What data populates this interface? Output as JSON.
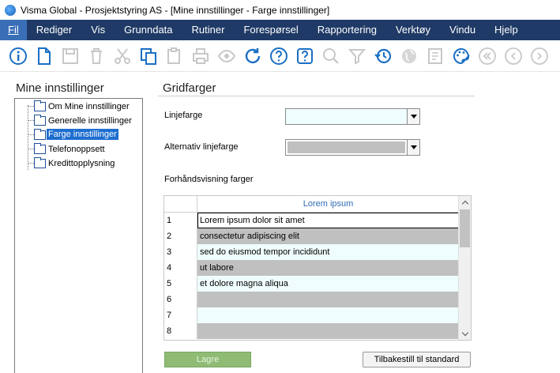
{
  "window": {
    "title": "Visma Global - Prosjektstyring AS - [Mine innstillinger - Farge innstillinger]"
  },
  "menu": [
    {
      "label": "Fil"
    },
    {
      "label": "Rediger"
    },
    {
      "label": "Vis"
    },
    {
      "label": "Grunndata"
    },
    {
      "label": "Rutiner"
    },
    {
      "label": "Forespørsel"
    },
    {
      "label": "Rapportering"
    },
    {
      "label": "Verktøy"
    },
    {
      "label": "Vindu"
    },
    {
      "label": "Hjelp"
    }
  ],
  "toolbar": {
    "icons": [
      "info-icon",
      "new-document-icon",
      "save-icon",
      "delete-icon",
      "cut-icon",
      "copy-icon",
      "paste-icon",
      "print-icon",
      "preview-icon",
      "refresh-icon",
      "help-icon",
      "context-help-icon",
      "search-icon",
      "filter-icon",
      "history-icon",
      "globe-icon",
      "notes-icon",
      "palette-icon",
      "first-icon",
      "previous-icon",
      "next-icon"
    ]
  },
  "sidebar": {
    "title": "Mine innstillinger",
    "items": [
      {
        "label": "Om Mine innstillinger",
        "selected": false
      },
      {
        "label": "Generelle innstillinger",
        "selected": false
      },
      {
        "label": "Farge innstillinger",
        "selected": true
      },
      {
        "label": "Telefonoppsett",
        "selected": false
      },
      {
        "label": "Kredittopplysning",
        "selected": false
      }
    ]
  },
  "main": {
    "title": "Gridfarger",
    "line_color_label": "Linjefarge",
    "line_color_value": "#f0fdfe",
    "alt_line_color_label": "Alternativ linjefarge",
    "alt_line_color_value": "#c0c0c0",
    "preview_label": "Forhåndsvisning farger",
    "grid": {
      "column_header": "Lorem ipsum",
      "rows": [
        {
          "num": "1",
          "text": "Lorem ipsum dolor sit amet"
        },
        {
          "num": "2",
          "text": "consectetur adipiscing elit"
        },
        {
          "num": "3",
          "text": "sed do eiusmod tempor incididunt"
        },
        {
          "num": "4",
          "text": "ut labore"
        },
        {
          "num": "5",
          "text": "et dolore magna aliqua"
        },
        {
          "num": "6",
          "text": ""
        },
        {
          "num": "7",
          "text": ""
        },
        {
          "num": "8",
          "text": ""
        }
      ]
    },
    "save_label": "Lagre",
    "reset_label": "Tilbakestill til standard"
  },
  "colors": {
    "menubar": "#1f3a66",
    "menu_active": "#3a6fb8",
    "selection": "#1e6ed0",
    "save_button": "#8fbb74"
  }
}
